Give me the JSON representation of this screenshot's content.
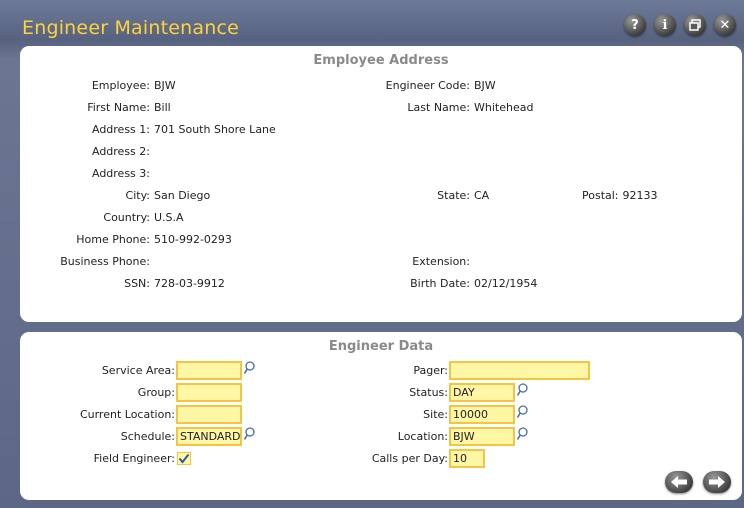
{
  "window": {
    "title": "Engineer Maintenance",
    "buttons": [
      "help-icon",
      "info-icon",
      "restore-icon",
      "close-icon"
    ],
    "accent_color": "#ffd23a"
  },
  "address": {
    "section_title": "Employee Address",
    "employee_label": "Employee:",
    "employee": "BJW",
    "engineer_code_label": "Engineer Code:",
    "engineer_code": "BJW",
    "first_name_label": "First Name:",
    "first_name": "Bill",
    "last_name_label": "Last Name:",
    "last_name": "Whitehead",
    "address1_label": "Address 1:",
    "address1": "701 South Shore Lane",
    "address2_label": "Address 2:",
    "address2": "",
    "address3_label": "Address 3:",
    "address3": "",
    "city_label": "City:",
    "city": "San Diego",
    "state_label": "State:",
    "state": "CA",
    "postal_label": "Postal:",
    "postal": "92133",
    "country_label": "Country:",
    "country": "U.S.A",
    "home_phone_label": "Home Phone:",
    "home_phone": "510-992-0293",
    "business_phone_label": "Business Phone:",
    "business_phone": "",
    "extension_label": "Extension:",
    "extension": "",
    "ssn_label": "SSN:",
    "ssn": "728-03-9912",
    "birth_date_label": "Birth Date:",
    "birth_date": "02/12/1954"
  },
  "engineer": {
    "section_title": "Engineer Data",
    "service_area_label": "Service Area:",
    "service_area": "",
    "group_label": "Group:",
    "group": "",
    "current_location_label": "Current Location:",
    "current_location": "",
    "schedule_label": "Schedule:",
    "schedule": "STANDARD",
    "field_engineer_label": "Field Engineer:",
    "field_engineer": "checked",
    "pager_label": "Pager:",
    "pager": "",
    "status_label": "Status:",
    "status": "DAY",
    "site_label": "Site:",
    "site": "10000",
    "location_label": "Location:",
    "location": "BJW",
    "calls_per_day_label": "Calls per Day:",
    "calls_per_day": "10"
  },
  "nav": {
    "back_icon": "arrow-left-icon",
    "forward_icon": "arrow-right-icon"
  }
}
